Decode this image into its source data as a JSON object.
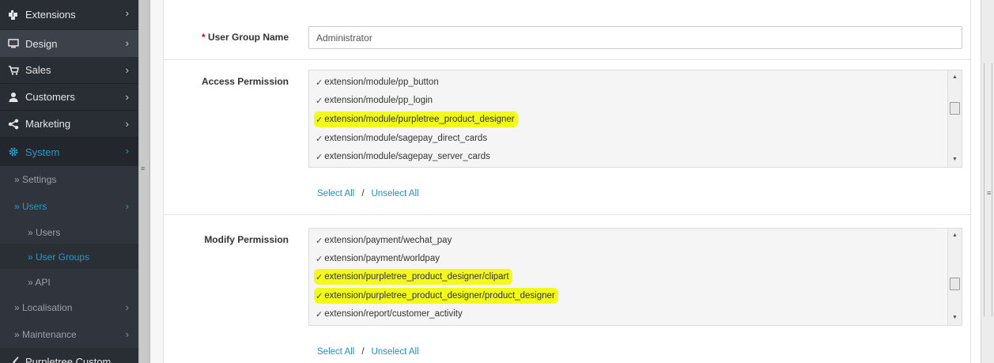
{
  "sidebar": {
    "items": [
      {
        "label": "Extensions",
        "icon": "puzzle-icon"
      },
      {
        "label": "Design",
        "icon": "monitor-icon"
      },
      {
        "label": "Sales",
        "icon": "cart-icon"
      },
      {
        "label": "Customers",
        "icon": "user-icon"
      },
      {
        "label": "Marketing",
        "icon": "share-icon"
      },
      {
        "label": "System",
        "icon": "gear-icon"
      }
    ],
    "sub_items": [
      {
        "label": "» Settings"
      },
      {
        "label": "» Users"
      },
      {
        "label": "» Users"
      },
      {
        "label": "» User Groups"
      },
      {
        "label": "» API"
      },
      {
        "label": "» Localisation"
      },
      {
        "label": "» Maintenance"
      }
    ],
    "extra_item": {
      "label": "Purpletree Custom",
      "icon": "brush-icon"
    },
    "chevron": "›"
  },
  "form": {
    "required_mark": "*",
    "group_name_label": "User Group Name",
    "group_name_value": "Administrator",
    "access_label": "Access Permission",
    "access_items": [
      {
        "text": "extension/module/pp_button",
        "highlighted": false
      },
      {
        "text": "extension/module/pp_login",
        "highlighted": false
      },
      {
        "text": "extension/module/purpletree_product_designer",
        "highlighted": true
      },
      {
        "text": "extension/module/sagepay_direct_cards",
        "highlighted": false
      },
      {
        "text": "extension/module/sagepay_server_cards",
        "highlighted": false
      }
    ],
    "modify_label": "Modify Permission",
    "modify_items": [
      {
        "text": "extension/payment/wechat_pay",
        "highlighted": false
      },
      {
        "text": "extension/payment/worldpay",
        "highlighted": false
      },
      {
        "text": "extension/purpletree_product_designer/clipart",
        "highlighted": true
      },
      {
        "text": "extension/purpletree_product_designer/product_designer",
        "highlighted": true
      },
      {
        "text": "extension/report/customer_activity",
        "highlighted": false
      }
    ],
    "select_all": "Select All",
    "separator": "/",
    "unselect_all": "Unselect All"
  },
  "colors": {
    "highlight": "#f3f91b",
    "link": "#1e91cf",
    "active_nav": "#229ac8",
    "required": "#d0021b"
  }
}
